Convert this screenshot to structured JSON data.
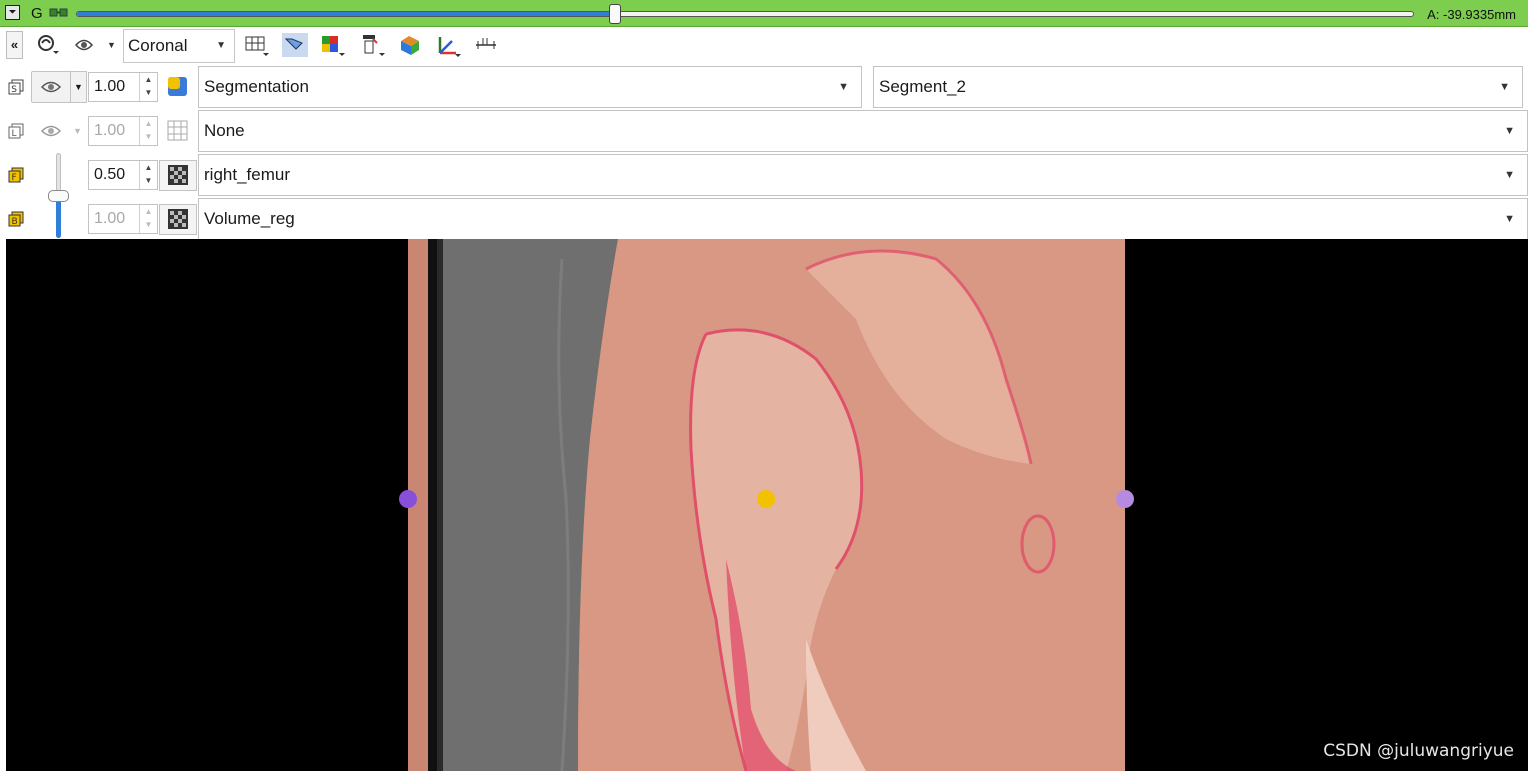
{
  "slice_bar": {
    "view_letter": "G",
    "offset_label": "A: -39.9335mm",
    "slider_fraction": 0.403,
    "color": "#7dcd4f"
  },
  "toolbar": {
    "collapse_label": "«",
    "orientation": "Coronal",
    "icons": [
      "link-views-icon",
      "visibility-icon",
      "layout-icon",
      "slice-intersection-icon",
      "segmentation-display-icon",
      "annotation-icon",
      "volume-render-icon",
      "reformat-icon",
      "ruler-icon"
    ]
  },
  "layers": {
    "segmentation": {
      "opacity": "1.00",
      "node": "Segmentation",
      "segment": "Segment_2"
    },
    "label": {
      "opacity": "1.00",
      "node": "None"
    },
    "foreground": {
      "opacity": "0.50",
      "node": "right_femur"
    },
    "background": {
      "opacity": "1.00",
      "node": "Volume_reg"
    }
  },
  "fader_fraction": 0.5,
  "watermark": "CSDN @juluwangriyue",
  "colors": {
    "accent_blue": "#2f7fd8",
    "marker_left": "#8a4fd9",
    "marker_center": "#f2c200",
    "marker_right": "#b58ae0",
    "overlay_tissue": "#d6907a"
  }
}
